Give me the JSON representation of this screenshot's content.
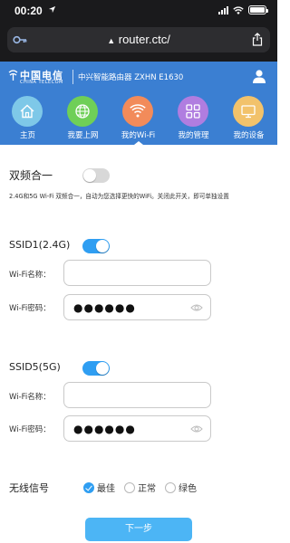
{
  "status_bar": {
    "time": "00:20"
  },
  "browser": {
    "url": "router.ctc/"
  },
  "app_header": {
    "brand_cn": "中国电信",
    "brand_en": "CHINA TELECOM",
    "model": "中兴智能路由器 ZXHN E1630"
  },
  "nav": {
    "items": [
      {
        "label": "主页",
        "icon": "home-icon",
        "color": "#7ec8e8"
      },
      {
        "label": "我要上网",
        "icon": "globe-icon",
        "color": "#6fcf57"
      },
      {
        "label": "我的Wi-Fi",
        "icon": "wifi-icon",
        "color": "#f28b5a",
        "active": true
      },
      {
        "label": "我的管理",
        "icon": "grid-icon",
        "color": "#b07de0"
      },
      {
        "label": "我的设备",
        "icon": "device-icon",
        "color": "#f2c26b"
      }
    ]
  },
  "dual_band": {
    "label": "双频合一",
    "enabled": false,
    "hint": "2.4G和5G Wi-Fi 双频合一，自动为您选择更快的WiFi。关闭此开关，即可单独设置"
  },
  "ssid24": {
    "label": "SSID1(2.4G)",
    "enabled": true,
    "name_label": "Wi-Fi名称：",
    "name_value": "",
    "pwd_label": "Wi-Fi密码：",
    "pwd_mask": "●●●●●●"
  },
  "ssid5": {
    "label": "SSID5(5G)",
    "enabled": true,
    "name_label": "Wi-Fi名称：",
    "name_value": "",
    "pwd_label": "Wi-Fi密码：",
    "pwd_mask": "●●●●●●"
  },
  "signal": {
    "label": "无线信号",
    "options": [
      "最佳",
      "正常",
      "绿色"
    ],
    "selected": "最佳"
  },
  "next_button": "下一步",
  "colors": {
    "header_blue": "#3b7fd2",
    "toggle_on": "#2f9ef2",
    "button": "#4cb5f5"
  }
}
